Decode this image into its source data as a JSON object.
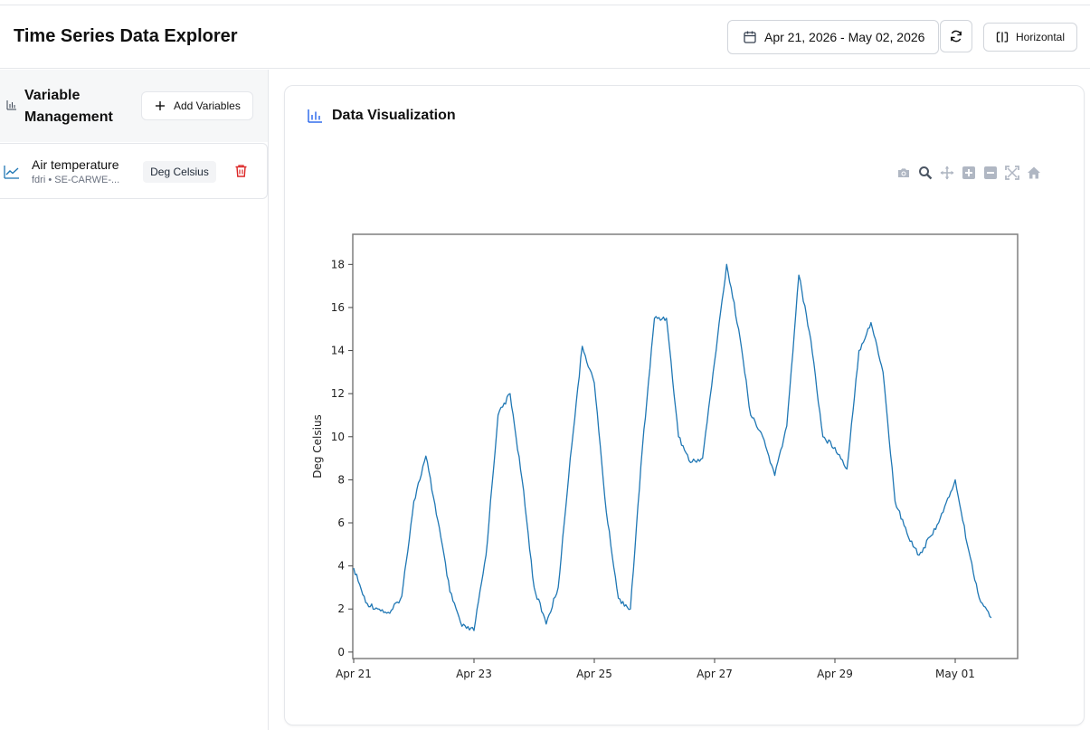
{
  "app": {
    "title": "Time Series Data Explorer"
  },
  "header": {
    "date_range": "Apr 21, 2026 - May 02, 2026",
    "layout_label": "Horizontal"
  },
  "sidebar": {
    "title": "Variable Management",
    "add_label": "Add Variables",
    "variables": [
      {
        "name": "Air temperature",
        "source": "fdri • SE-CARWE-...",
        "unit": "Deg Celsius",
        "color": "#1f77b4"
      }
    ]
  },
  "panel": {
    "title": "Data Visualization"
  },
  "modebar": {
    "icons": [
      "camera-icon",
      "zoom-icon",
      "pan-icon",
      "zoom-in-icon",
      "zoom-out-icon",
      "autoscale-icon",
      "reset-axes-icon"
    ]
  },
  "colors": {
    "line": "#1f77b4",
    "delete": "#dc2626",
    "accent": "#2563eb"
  },
  "chart_data": {
    "type": "line",
    "title": "",
    "xlabel": "",
    "ylabel": "Deg Celsius",
    "x_ticks": [
      "Apr 21",
      "Apr 23",
      "Apr 25",
      "Apr 27",
      "Apr 29",
      "May 01"
    ],
    "y_ticks": [
      0,
      2,
      4,
      6,
      8,
      10,
      12,
      14,
      16,
      18
    ],
    "xlim": [
      "2026-04-21",
      "2026-05-02"
    ],
    "ylim": [
      -0.3,
      19.4
    ],
    "series": [
      {
        "x": [
          "2026-04-21",
          "2026-04-21T04:48",
          "2026-04-21T09:36",
          "2026-04-21T14:24",
          "2026-04-21T19:12",
          "2026-04-22T00:00",
          "2026-04-22T04:48",
          "2026-04-22T09:36",
          "2026-04-22T14:24",
          "2026-04-22T19:12",
          "2026-04-23T00:00",
          "2026-04-23T04:48",
          "2026-04-23T09:36",
          "2026-04-23T14:24",
          "2026-04-23T19:12",
          "2026-04-24T00:00",
          "2026-04-24T04:48",
          "2026-04-24T09:36",
          "2026-04-24T14:24",
          "2026-04-24T19:12",
          "2026-04-25T00:00",
          "2026-04-25T04:48",
          "2026-04-25T09:36",
          "2026-04-25T14:24",
          "2026-04-25T19:12",
          "2026-04-26T00:00",
          "2026-04-26T04:48",
          "2026-04-26T09:36",
          "2026-04-26T14:24",
          "2026-04-26T19:12",
          "2026-04-27T00:00",
          "2026-04-27T04:48",
          "2026-04-27T09:36",
          "2026-04-27T14:24",
          "2026-04-27T19:12",
          "2026-04-28T00:00",
          "2026-04-28T04:48",
          "2026-04-28T09:36",
          "2026-04-28T14:24",
          "2026-04-28T19:12",
          "2026-04-29T00:00",
          "2026-04-29T04:48",
          "2026-04-29T09:36",
          "2026-04-29T14:24",
          "2026-04-29T19:12",
          "2026-04-30T00:00",
          "2026-04-30T04:48",
          "2026-04-30T09:36",
          "2026-04-30T14:24",
          "2026-04-30T19:12",
          "2026-05-01T00:00",
          "2026-05-01T04:48",
          "2026-05-01T09:36",
          "2026-05-01T14:24"
        ],
        "values": [
          3.9,
          2.3,
          2.0,
          1.8,
          2.6,
          7.0,
          9.1,
          6.1,
          2.8,
          1.2,
          1.0,
          4.5,
          11.0,
          12.0,
          8.0,
          3.0,
          1.3,
          3.0,
          9.0,
          14.2,
          12.5,
          6.5,
          2.5,
          2.0,
          9.5,
          15.5,
          15.5,
          10.0,
          8.8,
          9.0,
          13.5,
          18.0,
          15.0,
          11.0,
          10.0,
          8.2,
          10.5,
          17.5,
          14.5,
          10.0,
          9.5,
          8.5,
          14.0,
          15.3,
          13.0,
          7.0,
          5.5,
          4.5,
          5.4,
          6.5,
          8.0,
          5.0,
          2.5,
          1.6
        ]
      }
    ]
  }
}
